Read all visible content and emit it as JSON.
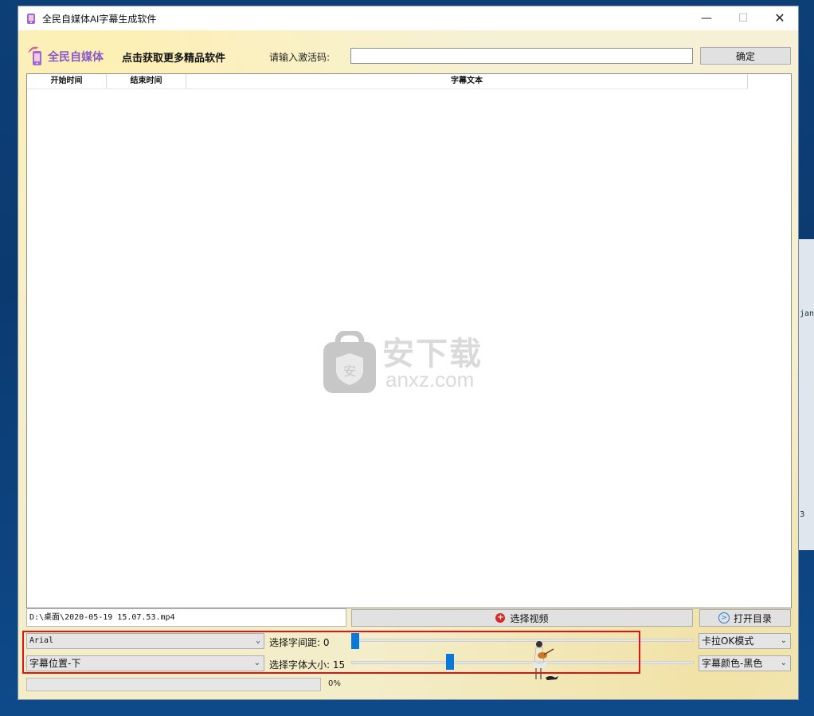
{
  "window": {
    "title": "全民自媒体AI字幕生成软件"
  },
  "header": {
    "logo_text": "全民自媒体",
    "promo_link": "点击获取更多精品软件",
    "activation_label": "请输入激活码:",
    "activation_value": "",
    "ok_button": "确定"
  },
  "table": {
    "columns": [
      "开始时间",
      "结束时间",
      "字幕文本"
    ],
    "rows": []
  },
  "watermark": {
    "cn": "安下载",
    "en": "anxz.com",
    "shield_char": "安"
  },
  "video": {
    "path": "D:\\桌面\\2020-05-19 15.07.53.mp4",
    "choose_button": "选择视频",
    "open_dir_button": "打开目录"
  },
  "settings": {
    "font": "Arial",
    "position": "字幕位置-下",
    "spacing_label": "选择字间距: 0",
    "spacing_value": 0,
    "size_label": "选择字体大小: 15",
    "size_value": 15,
    "karaoke_mode": "卡拉OK模式",
    "subtitle_color": "字幕颜色-黑色"
  },
  "progress": {
    "percent": 0,
    "label": "0%"
  },
  "desktop": {
    "side_text": "jan",
    "side_text2": "3"
  },
  "colors": {
    "accent_blue": "#0a78d7",
    "highlight_red": "#e01414",
    "logo_purple": "#8a58c8"
  },
  "icons": {
    "add": "add-circle-icon",
    "open": "arrow-circle-icon"
  }
}
